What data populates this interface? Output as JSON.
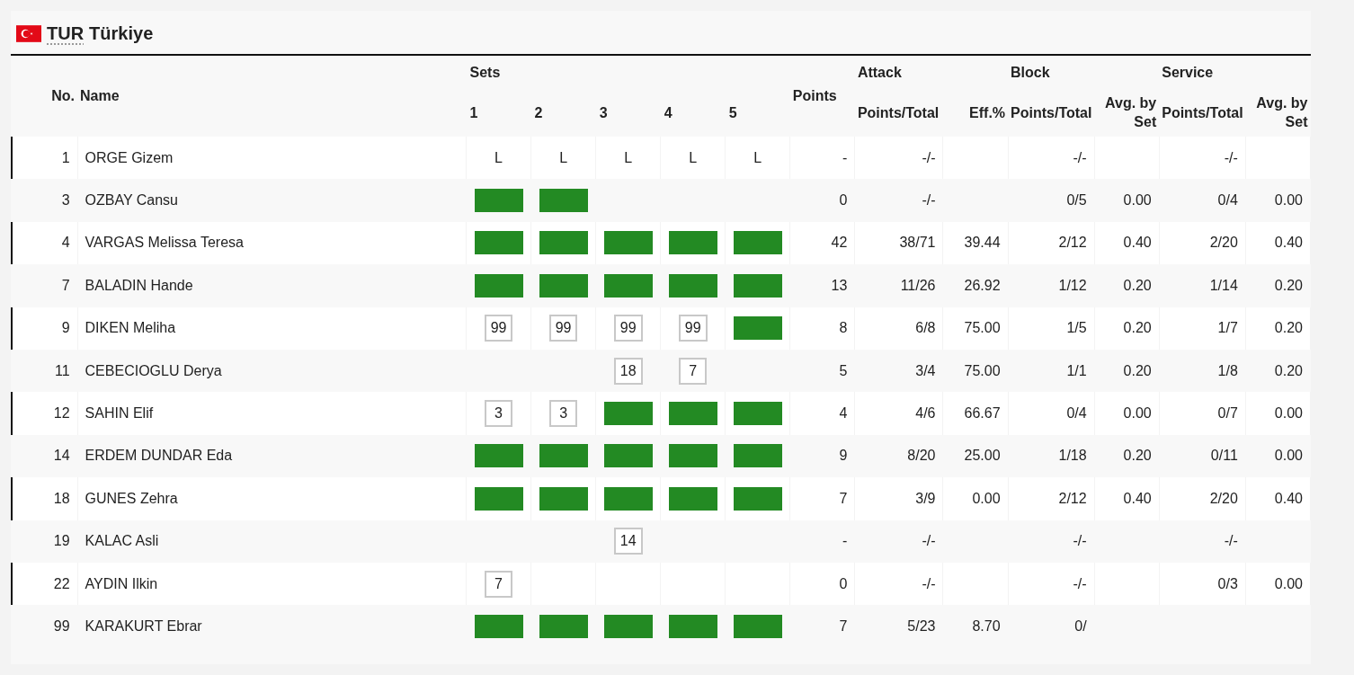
{
  "team": {
    "code": "TUR",
    "name": "Türkiye"
  },
  "header": {
    "no": "No.",
    "name": "Name",
    "sets": "Sets",
    "set_numbers": [
      "1",
      "2",
      "3",
      "4",
      "5"
    ],
    "points": "Points",
    "groups": [
      "Attack",
      "Block",
      "Service"
    ],
    "subcolumns": [
      "Points/Total",
      "Eff.%",
      "Points/Total",
      "Avg. by Set",
      "Points/Total",
      "Avg. by Set"
    ]
  },
  "players": [
    {
      "no": "1",
      "name": "ORGE Gizem",
      "sets": [
        {
          "kind": "libero",
          "label": "L"
        },
        {
          "kind": "libero",
          "label": "L"
        },
        {
          "kind": "libero",
          "label": "L"
        },
        {
          "kind": "libero",
          "label": "L"
        },
        {
          "kind": "libero",
          "label": "L"
        }
      ],
      "points": "-",
      "stats": {
        "attack_points": "-/-",
        "block_points": "-/-",
        "service_points": "-/-"
      }
    },
    {
      "no": "3",
      "name": "OZBAY Cansu",
      "sets": [
        {
          "kind": "starter"
        },
        {
          "kind": "starter"
        },
        {
          "kind": "none"
        },
        {
          "kind": "none"
        },
        {
          "kind": "none"
        }
      ],
      "points": "0",
      "stats": {
        "attack_points": "-/-",
        "block_points": "0/5",
        "block_avg": "0.00",
        "service_points": "0/4",
        "service_avg": "0.00"
      }
    },
    {
      "no": "4",
      "name": "VARGAS Melissa Teresa",
      "sets": [
        {
          "kind": "starter"
        },
        {
          "kind": "starter"
        },
        {
          "kind": "starter"
        },
        {
          "kind": "starter"
        },
        {
          "kind": "starter"
        }
      ],
      "points": "42",
      "stats": {
        "attack_points": "38/71",
        "attack_eff": "39.44",
        "block_points": "2/12",
        "block_avg": "0.40",
        "service_points": "2/20",
        "service_avg": "0.40"
      }
    },
    {
      "no": "7",
      "name": "BALADIN Hande",
      "sets": [
        {
          "kind": "starter"
        },
        {
          "kind": "starter"
        },
        {
          "kind": "starter"
        },
        {
          "kind": "starter"
        },
        {
          "kind": "starter"
        }
      ],
      "points": "13",
      "stats": {
        "attack_points": "11/26",
        "attack_eff": "26.92",
        "block_points": "1/12",
        "block_avg": "0.20",
        "service_points": "1/14",
        "service_avg": "0.20"
      }
    },
    {
      "no": "9",
      "name": "DIKEN Meliha",
      "sets": [
        {
          "kind": "sub",
          "label": "99"
        },
        {
          "kind": "sub",
          "label": "99"
        },
        {
          "kind": "sub",
          "label": "99"
        },
        {
          "kind": "sub",
          "label": "99"
        },
        {
          "kind": "starter"
        }
      ],
      "points": "8",
      "stats": {
        "attack_points": "6/8",
        "attack_eff": "75.00",
        "block_points": "1/5",
        "block_avg": "0.20",
        "service_points": "1/7",
        "service_avg": "0.20"
      }
    },
    {
      "no": "11",
      "name": "CEBECIOGLU Derya",
      "sets": [
        {
          "kind": "none"
        },
        {
          "kind": "none"
        },
        {
          "kind": "sub",
          "label": "18"
        },
        {
          "kind": "sub",
          "label": "7"
        },
        {
          "kind": "none"
        }
      ],
      "points": "5",
      "stats": {
        "attack_points": "3/4",
        "attack_eff": "75.00",
        "block_points": "1/1",
        "block_avg": "0.20",
        "service_points": "1/8",
        "service_avg": "0.20"
      }
    },
    {
      "no": "12",
      "name": "SAHIN Elif",
      "sets": [
        {
          "kind": "sub",
          "label": "3"
        },
        {
          "kind": "sub",
          "label": "3"
        },
        {
          "kind": "starter"
        },
        {
          "kind": "starter"
        },
        {
          "kind": "starter"
        }
      ],
      "points": "4",
      "stats": {
        "attack_points": "4/6",
        "attack_eff": "66.67",
        "block_points": "0/4",
        "block_avg": "0.00",
        "service_points": "0/7",
        "service_avg": "0.00"
      }
    },
    {
      "no": "14",
      "name": "ERDEM DUNDAR Eda",
      "sets": [
        {
          "kind": "starter"
        },
        {
          "kind": "starter"
        },
        {
          "kind": "starter"
        },
        {
          "kind": "starter"
        },
        {
          "kind": "starter"
        }
      ],
      "points": "9",
      "stats": {
        "attack_points": "8/20",
        "attack_eff": "25.00",
        "block_points": "1/18",
        "block_avg": "0.20",
        "service_points": "0/11",
        "service_avg": "0.00"
      }
    },
    {
      "no": "18",
      "name": "GUNES Zehra",
      "sets": [
        {
          "kind": "starter"
        },
        {
          "kind": "starter"
        },
        {
          "kind": "starter"
        },
        {
          "kind": "starter"
        },
        {
          "kind": "starter"
        }
      ],
      "points": "7",
      "stats": {
        "attack_points": "3/9",
        "attack_eff": "0.00",
        "block_points": "2/12",
        "block_avg": "0.40",
        "service_points": "2/20",
        "service_avg": "0.40"
      }
    },
    {
      "no": "19",
      "name": "KALAC Asli",
      "sets": [
        {
          "kind": "none"
        },
        {
          "kind": "none"
        },
        {
          "kind": "sub",
          "label": "14"
        },
        {
          "kind": "none"
        },
        {
          "kind": "none"
        }
      ],
      "points": "-",
      "stats": {
        "attack_points": "-/-",
        "block_points": "-/-",
        "service_points": "-/-"
      }
    },
    {
      "no": "22",
      "name": "AYDIN Ilkin",
      "sets": [
        {
          "kind": "sub",
          "label": "7"
        },
        {
          "kind": "none"
        },
        {
          "kind": "none"
        },
        {
          "kind": "none"
        },
        {
          "kind": "none"
        }
      ],
      "points": "0",
      "stats": {
        "attack_points": "-/-",
        "block_points": "-/-",
        "service_points": "0/3",
        "service_avg": "0.00"
      }
    },
    {
      "no": "99",
      "name": "KARAKURT Ebrar",
      "sets": [
        {
          "kind": "starter"
        },
        {
          "kind": "starter"
        },
        {
          "kind": "starter"
        },
        {
          "kind": "starter"
        },
        {
          "kind": "starter"
        }
      ],
      "points": "7",
      "stats": {
        "attack_points": "5/23",
        "attack_eff": "8.70",
        "block_points": "0/"
      }
    }
  ]
}
